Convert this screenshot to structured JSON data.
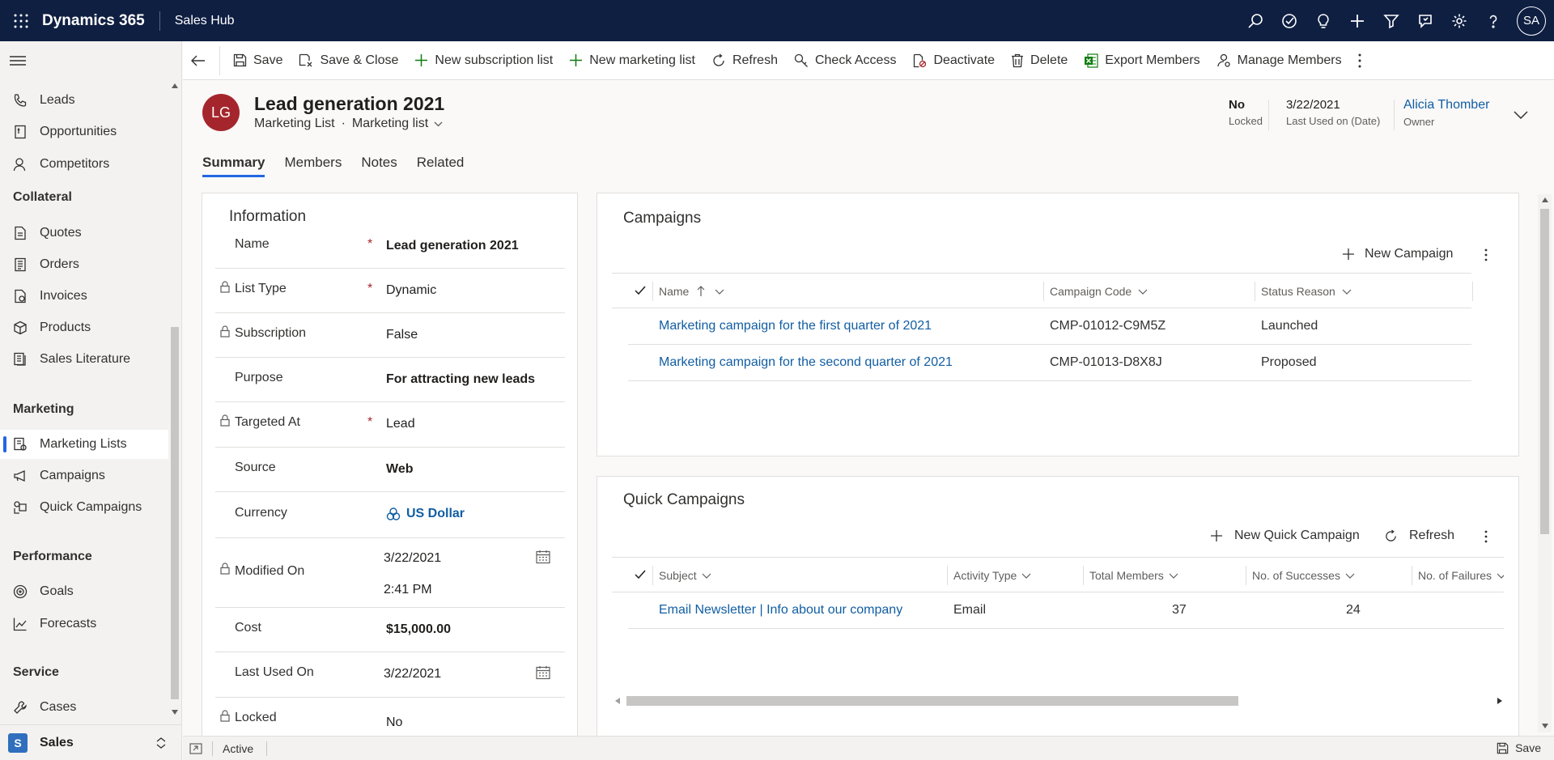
{
  "app": {
    "brand": "Dynamics 365",
    "name": "Sales Hub",
    "user_initials": "SA"
  },
  "top_icons": [
    "search-icon",
    "task-check-icon",
    "lightbulb-icon",
    "plus-icon",
    "filter-icon",
    "assistant-icon",
    "gear-icon",
    "help-icon"
  ],
  "sidebar": {
    "items_top": [
      "Leads",
      "Opportunities",
      "Competitors"
    ],
    "collateral_title": "Collateral",
    "collateral": [
      "Quotes",
      "Orders",
      "Invoices",
      "Products",
      "Sales Literature"
    ],
    "marketing_title": "Marketing",
    "marketing": [
      "Marketing Lists",
      "Campaigns",
      "Quick Campaigns"
    ],
    "performance_title": "Performance",
    "performance": [
      "Goals",
      "Forecasts"
    ],
    "service_title": "Service",
    "service": [
      "Cases"
    ],
    "area": {
      "badge": "S",
      "label": "Sales"
    }
  },
  "commands": {
    "save": "Save",
    "save_close": "Save & Close",
    "new_subscription": "New subscription list",
    "new_marketing": "New marketing list",
    "refresh": "Refresh",
    "check_access": "Check Access",
    "deactivate": "Deactivate",
    "delete": "Delete",
    "export": "Export Members",
    "manage": "Manage Members"
  },
  "record": {
    "initials": "LG",
    "title": "Lead generation 2021",
    "entity": "Marketing List",
    "sep": "·",
    "form": "Marketing list",
    "locked_value": "No",
    "locked_label": "Locked",
    "last_used_value": "3/22/2021",
    "last_used_label": "Last Used on (Date)",
    "owner_value": "Alicia Thomber",
    "owner_label": "Owner"
  },
  "tabs": [
    "Summary",
    "Members",
    "Notes",
    "Related"
  ],
  "information": {
    "title": "Information",
    "name_label": "Name",
    "name_value": "Lead generation 2021",
    "list_type_label": "List Type",
    "list_type_value": "Dynamic",
    "subscription_label": "Subscription",
    "subscription_value": "False",
    "purpose_label": "Purpose",
    "purpose_value": "For attracting new leads",
    "targeted_label": "Targeted At",
    "targeted_value": "Lead",
    "source_label": "Source",
    "source_value": "Web",
    "currency_label": "Currency",
    "currency_value": "US Dollar",
    "modified_label": "Modified On",
    "modified_date": "3/22/2021",
    "modified_time": "2:41 PM",
    "cost_label": "Cost",
    "cost_value": "$15,000.00",
    "last_used_label": "Last Used On",
    "last_used_value": "3/22/2021",
    "locked_label": "Locked",
    "locked_value": "No",
    "required_mark": "*"
  },
  "campaigns": {
    "title": "Campaigns",
    "new_label": "New Campaign",
    "columns": {
      "name": "Name",
      "code": "Campaign Code",
      "status": "Status Reason"
    },
    "rows": [
      {
        "name": "Marketing campaign for the first quarter of 2021",
        "code": "CMP-01012-C9M5Z",
        "status": "Launched"
      },
      {
        "name": "Marketing campaign for the second quarter of 2021",
        "code": "CMP-01013-D8X8J",
        "status": "Proposed"
      }
    ]
  },
  "quick_campaigns": {
    "title": "Quick Campaigns",
    "new_label": "New Quick Campaign",
    "refresh_label": "Refresh",
    "columns": {
      "subject": "Subject",
      "activity": "Activity Type",
      "total": "Total Members",
      "successes": "No. of Successes",
      "failures": "No. of Failures"
    },
    "rows": [
      {
        "subject": "Email Newsletter | Info about our company",
        "activity": "Email",
        "total": "37",
        "successes": "24"
      }
    ]
  },
  "status": {
    "state": "Active",
    "save": "Save"
  }
}
